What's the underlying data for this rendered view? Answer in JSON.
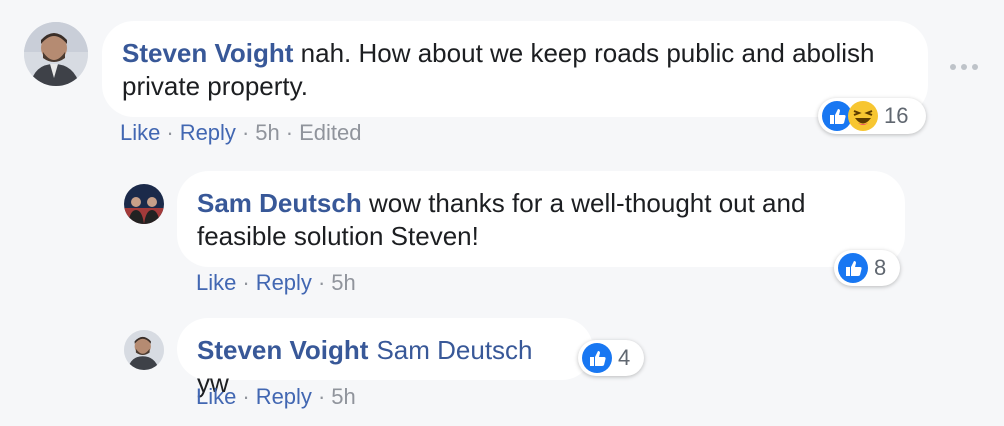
{
  "theme": {
    "page_bg": "#f6f7f9",
    "name_color": "#385898",
    "link_color": "#4267b2",
    "like_blue": "#1877f2"
  },
  "comments": [
    {
      "author": "Steven Voight",
      "text": " nah. How about we keep roads public and abolish private property.",
      "actions": {
        "like": "Like",
        "reply": "Reply",
        "time": "5h",
        "edited": "Edited"
      },
      "reactions": {
        "icons": [
          "like-icon",
          "haha-icon"
        ],
        "count": "16"
      }
    },
    {
      "author": "Sam Deutsch",
      "text": " wow thanks for a well-thought out and feasible solution Steven!",
      "actions": {
        "like": "Like",
        "reply": "Reply",
        "time": "5h"
      },
      "reactions": {
        "icons": [
          "like-icon"
        ],
        "count": "8"
      }
    },
    {
      "author": "Steven Voight",
      "mention": "Sam Deutsch",
      "text": " yw",
      "actions": {
        "like": "Like",
        "reply": "Reply",
        "time": "5h"
      },
      "reactions": {
        "icons": [
          "like-icon"
        ],
        "count": "4"
      }
    }
  ],
  "ui": {
    "more_icon": "more-horizontal-icon",
    "separator": "·"
  }
}
